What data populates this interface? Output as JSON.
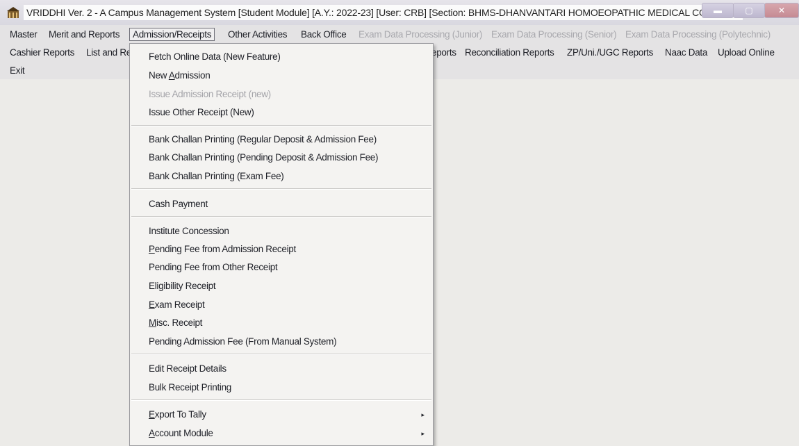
{
  "window": {
    "title": "VRIDDHI Ver. 2 - A Campus Management System [Student Module] [A.Y.: 2022-23] [User: CRB] [Section: BHMS-DHANVANTARI HOMOEOPATHIC MEDICAL COLLEGE]",
    "icon": "app-building-icon",
    "buttons": [
      "minimize-icon",
      "maximize-icon",
      "close-icon"
    ]
  },
  "menubar": {
    "row1": {
      "master": "Master",
      "merit": "Merit and Reports",
      "admission": "Admission/Receipts",
      "other": "Other Activities",
      "back_office": "Back Office",
      "exam_junior": "Exam Data Processing (Junior)",
      "exam_senior": "Exam Data Processing (Senior)",
      "exam_poly": "Exam Data Processing (Polytechnic)"
    },
    "row2": {
      "cashier": "Cashier Reports",
      "list_partial": "List and Re",
      "reports_partial": "eports",
      "reconciliation": "Reconciliation Reports",
      "zp": "ZP/Uni./UGC Reports",
      "naac": "Naac Data",
      "upload": "Upload Online"
    },
    "row3": {
      "exit": "Exit"
    }
  },
  "dropdown": {
    "fetch_online": "Fetch Online Data (New Feature)",
    "new_admission": {
      "pre": "New ",
      "u": "A",
      "post": "dmission"
    },
    "issue_admission": "Issue Admission Receipt (new)",
    "issue_other": "Issue Other Receipt (New)",
    "bank_regular": "Bank Challan Printing (Regular Deposit & Admission Fee)",
    "bank_pending": "Bank Challan Printing (Pending Deposit & Admission Fee)",
    "bank_exam": "Bank Challan Printing (Exam Fee)",
    "cash_payment": "Cash Payment",
    "institute_concession": "Institute Concession",
    "pending_admission": {
      "u": "P",
      "post": "ending Fee from Admission Receipt"
    },
    "pending_other": "Pending Fee from Other Receipt",
    "eligibility": "Eligibility Receipt",
    "exam_receipt": {
      "u": "E",
      "post": "xam Receipt"
    },
    "misc_receipt": {
      "u": "M",
      "post": "isc. Receipt"
    },
    "pending_manual": "Pending Admission Fee (From Manual System)",
    "edit_receipt": "Edit Receipt Details",
    "bulk_receipt": "Bulk Receipt Printing",
    "export_tally": {
      "u": "E",
      "post": "xport To Tally"
    },
    "account_module": {
      "u": "A",
      "post": "ccount Module"
    },
    "submenu_arrow": "▸"
  }
}
